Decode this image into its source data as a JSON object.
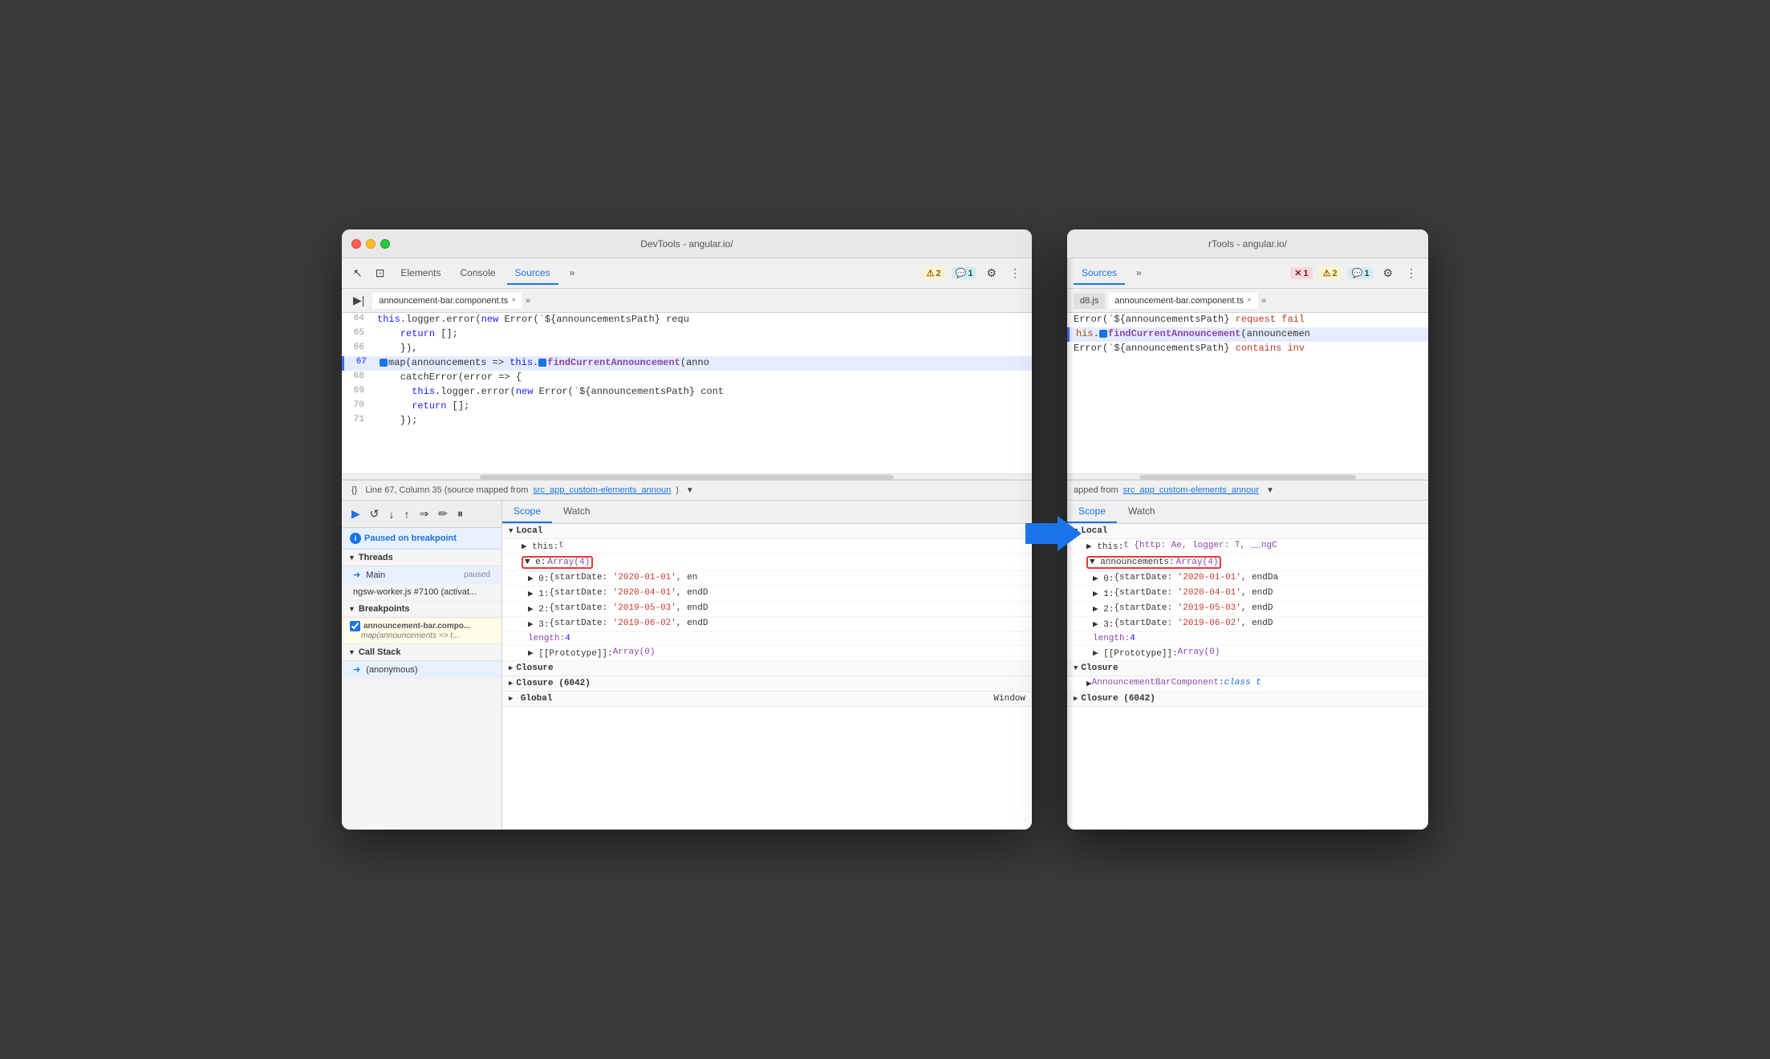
{
  "leftWindow": {
    "titleBar": {
      "title": "DevTools - angular.io/"
    },
    "toolbar": {
      "tabs": [
        "Elements",
        "Console",
        "Sources"
      ],
      "activeTab": "Sources",
      "badges": [
        {
          "icon": "⚠",
          "count": "2",
          "type": "warning"
        },
        {
          "icon": "💬",
          "count": "1",
          "type": "info"
        }
      ],
      "moreBtn": "»",
      "settingsBtn": "⚙",
      "menuBtn": "⋮"
    },
    "fileTabBar": {
      "expandBtn": "▶|",
      "tabs": [
        {
          "name": "announcement-bar.component.ts",
          "active": true
        },
        {
          "name": "»"
        }
      ],
      "closeBtn": "×"
    },
    "codeLines": [
      {
        "num": 64,
        "content": "this.logger.error(new Error(`${announcementsPath} requ",
        "highlight": false
      },
      {
        "num": 65,
        "content": "return [];",
        "highlight": false
      },
      {
        "num": 66,
        "content": "}),",
        "highlight": false
      },
      {
        "num": 67,
        "content": "map(announcements => this.findCurrentAnnouncement(anno",
        "highlight": true,
        "hasMarker": true
      },
      {
        "num": 68,
        "content": "catchError(error => {",
        "highlight": false
      },
      {
        "num": 69,
        "content": "this.logger.error(new Error(`${announcementsPath} cont",
        "highlight": false
      },
      {
        "num": 70,
        "content": "return [];",
        "highlight": false
      },
      {
        "num": 71,
        "content": "});",
        "highlight": false
      }
    ],
    "statusBar": {
      "formatBtn": "{}",
      "position": "Line 67, Column 35 (source mapped from ",
      "link": "src_app_custom-elements_announ",
      "dropdownBtn": "▼"
    },
    "debugToolbar": {
      "buttons": [
        "▶",
        "↺",
        "↓",
        "↑",
        "⇒",
        "✏",
        "⏸"
      ]
    },
    "pausedNotice": "Paused on breakpoint",
    "threads": {
      "sectionLabel": "Threads",
      "items": [
        {
          "name": "Main",
          "status": "paused",
          "selected": true
        },
        {
          "name": "ngsw-worker.js #7100 (activat..."
        }
      ]
    },
    "breakpoints": {
      "sectionLabel": "Breakpoints",
      "items": [
        {
          "filename": "announcement-bar.compo...",
          "code": "map(announcements => t..."
        }
      ]
    },
    "callStack": {
      "sectionLabel": "Call Stack",
      "items": [
        {
          "name": "(anonymous)"
        }
      ]
    },
    "scope": {
      "tabs": [
        "Scope",
        "Watch"
      ],
      "activeTab": "Scope",
      "sections": [
        {
          "name": "Local",
          "items": [
            {
              "key": "▶ this:",
              "val": "t",
              "indent": 1
            },
            {
              "key": "▼ e:",
              "val": "Array(4)",
              "highlight": true,
              "indent": 1
            },
            {
              "key": "▶ 0:",
              "val": "{startDate: '2020-01-01', en",
              "indent": 2,
              "strVal": true
            },
            {
              "key": "▶ 1:",
              "val": "{startDate: '2020-04-01', endD",
              "indent": 2,
              "strVal": true
            },
            {
              "key": "▶ 2:",
              "val": "{startDate: '2019-05-03', endD",
              "indent": 2,
              "strVal": true
            },
            {
              "key": "▶ 3:",
              "val": "{startDate: '2019-06-02', endD",
              "indent": 2,
              "strVal": true
            },
            {
              "key": "length:",
              "val": "4",
              "indent": 2,
              "numVal": true
            },
            {
              "key": "▶ [[Prototype]]:",
              "val": "Array(0)",
              "indent": 2
            }
          ]
        },
        {
          "name": "Closure",
          "items": []
        },
        {
          "name": "Closure (6042)",
          "items": []
        },
        {
          "name": "Global",
          "items": [
            {
              "key": "",
              "val": "Window",
              "align": "right"
            }
          ]
        }
      ]
    }
  },
  "rightWindow": {
    "titleBar": {
      "title": "rTools - angular.io/"
    },
    "toolbar": {
      "activeTab": "Sources",
      "moreBtn": "»",
      "badges": [
        {
          "icon": "✕",
          "count": "1",
          "type": "error"
        },
        {
          "icon": "⚠",
          "count": "2",
          "type": "warning"
        },
        {
          "icon": "💬",
          "count": "1",
          "type": "info"
        }
      ],
      "settingsBtn": "⚙",
      "menuBtn": "⋮"
    },
    "fileTabBar": {
      "tabs": [
        "d8.js",
        "announcement-bar.component.ts"
      ],
      "activeTab": "announcement-bar.component.ts",
      "closeBtn": "×",
      "moreBtn": "»"
    },
    "codeLines": [
      {
        "num": null,
        "content": "Error(`${announcementsPath} request fail",
        "highlight": false
      },
      {
        "num": null,
        "content": "his.findCurrentAnnouncement(announcemen",
        "highlight": true,
        "hasMarker": true
      },
      {
        "num": null,
        "content": "Error(`${announcementsPath} contains inv",
        "highlight": false
      }
    ],
    "statusBar": {
      "position": "apped from ",
      "link": "src_app_custom-elements_annour",
      "dropdownBtn": "▼"
    },
    "scope": {
      "tabs": [
        "Scope",
        "Watch"
      ],
      "activeTab": "Scope",
      "sections": [
        {
          "name": "Local",
          "items": [
            {
              "key": "▶ this:",
              "val": "t {http: Ae, logger: T, __ngC",
              "indent": 1
            },
            {
              "key": "▼ announcements:",
              "val": "Array(4)",
              "highlight": true,
              "indent": 1
            },
            {
              "key": "▶ 0:",
              "val": "{startDate: '2020-01-01', endDa",
              "indent": 2,
              "strVal": true
            },
            {
              "key": "▶ 1:",
              "val": "{startDate: '2020-04-01', endD",
              "indent": 2,
              "strVal": true
            },
            {
              "key": "▶ 2:",
              "val": "{startDate: '2019-05-03', endD",
              "indent": 2,
              "strVal": true
            },
            {
              "key": "▶ 3:",
              "val": "{startDate: '2019-06-02', endD",
              "indent": 2,
              "strVal": true
            },
            {
              "key": "length:",
              "val": "4",
              "indent": 2,
              "numVal": true
            },
            {
              "key": "▶ [[Prototype]]:",
              "val": "Array(0)",
              "indent": 2
            }
          ]
        },
        {
          "name": "Closure",
          "items": [
            {
              "key": "▶ AnnouncementBarComponent:",
              "val": "class t",
              "indent": 1,
              "linkVal": true
            }
          ]
        },
        {
          "name": "Closure (6042)",
          "items": []
        }
      ]
    }
  },
  "blueArrow": "➜"
}
